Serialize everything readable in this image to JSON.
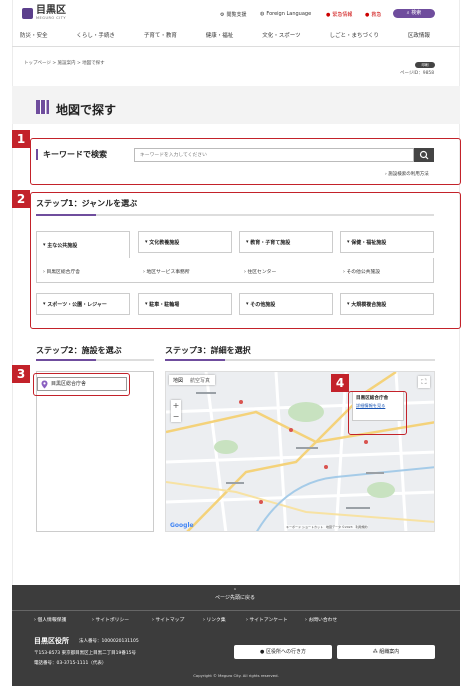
{
  "header": {
    "logo_title": "目黒区",
    "logo_sub": "MEGURO CITY",
    "util_reading": "閲覧支援",
    "util_foreign": "Foreign Language",
    "util_emergency": "緊急情報",
    "util_kyukyu": "救急",
    "search_button": "検索"
  },
  "global_nav": [
    "防災・安全",
    "くらし・手続き",
    "子育て・教育",
    "健康・福祉",
    "文化・スポーツ",
    "しごと・まちづくり",
    "区政情報"
  ],
  "breadcrumb": "トップページ > 施設案内 > 地図で探す",
  "print_label": "印刷",
  "page_id": "ページID：9858",
  "page_title": "地図で探す",
  "annotations": [
    "1",
    "2",
    "3",
    "4"
  ],
  "keyword": {
    "label": "キーワードで検索",
    "placeholder": "キーワードを入力してください",
    "help_link": "施設検索の利用方法"
  },
  "step1": {
    "heading": "ステップ1：ジャンルを選ぶ",
    "genres_row1": [
      "主な公共施設",
      "文化教養施設",
      "教育・子育て施設",
      "保健・福祉施設"
    ],
    "facilities": [
      "目黒区総合庁舎",
      "地区サービス事務所",
      "住区センター",
      "その他公共施設"
    ],
    "genres_row2": [
      "スポーツ・公園・レジャー",
      "駐車・駐輪場",
      "その他施設",
      "大規模複合施設"
    ]
  },
  "step2": {
    "heading": "ステップ2：施設を選ぶ",
    "items": [
      "目黒区総合庁舎"
    ]
  },
  "step3": {
    "heading": "ステップ3：詳細を選択",
    "map_tab_map": "地図",
    "map_tab_satellite": "航空写真",
    "info_title": "目黒区総合庁舎",
    "info_link": "詳細情報を見る",
    "google": "Google",
    "map_credit": "キーボード ショートカット　地図データ ©2023　利用規約"
  },
  "footer": {
    "page_top": "ページ先頭に戻る",
    "links": [
      "個人情報保護",
      "サイトポリシー",
      "サイトマップ",
      "リンク集",
      "サイトアンケート",
      "お問い合わせ"
    ],
    "office_name": "目黒区役所",
    "corp_no": "法人番号：1000020131105",
    "address": "〒153-8573 東京都目黒区上目黒二丁目19番15号",
    "phone": "電話番号：03-3715-1111（代表）",
    "access_button": "区役所への行き方",
    "org_button": "組織案内",
    "copyright": "Copyright © Meguro City. All rights reserved."
  },
  "colors": {
    "brand": "#6f4d9d",
    "annotation": "#c3222a",
    "footer_bg": "#3c3c3c"
  }
}
